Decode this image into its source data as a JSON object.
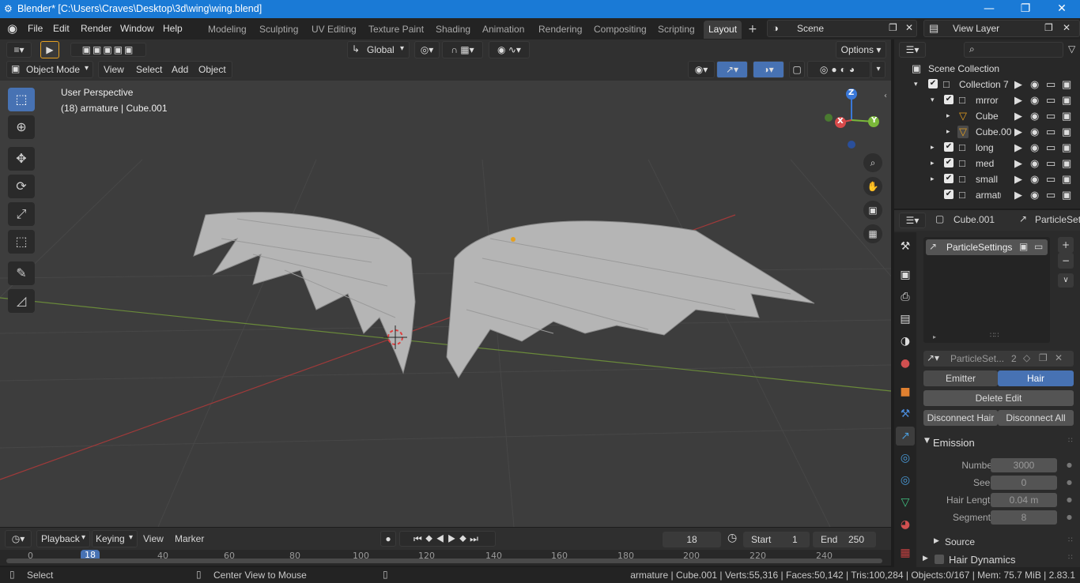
{
  "window": {
    "title": "Blender* [C:\\Users\\Craves\\Desktop\\3d\\wing\\wing.blend]",
    "minimize": "—",
    "maximize": "❐",
    "close": "✕",
    "icon": "blender-icon"
  },
  "menu": [
    "File",
    "Edit",
    "Render",
    "Window",
    "Help"
  ],
  "workspaces": [
    "Modeling",
    "Sculpting",
    "UV Editing",
    "Texture Paint",
    "Shading",
    "Animation",
    "Rendering",
    "Compositing",
    "Scripting",
    "Layout"
  ],
  "active_workspace": "Layout",
  "scene": "Scene",
  "view_layer": "View Layer",
  "viewport": {
    "mode": "Object Mode",
    "menus": [
      "View",
      "Select",
      "Add",
      "Object"
    ],
    "transform": "Global",
    "options": "Options",
    "info_line1": "User Perspective",
    "info_line2": "(18) armature | Cube.001",
    "gizmo": {
      "z": "Z",
      "y": "Y",
      "x": "X"
    }
  },
  "outliner": {
    "root": "Scene Collection",
    "rows": [
      "Collection 7",
      "mrror",
      "Cube",
      "Cube.00",
      "long",
      "med",
      "small",
      "armature"
    ]
  },
  "properties": {
    "object": "Cube.001",
    "settings_name": "ParticleSet",
    "slot": "ParticleSettings",
    "data_name": "ParticleSet...",
    "users": "2",
    "type_emitter": "Emitter",
    "type_hair": "Hair",
    "delete_edit": "Delete Edit",
    "disconnect_hair": "Disconnect Hair",
    "disconnect_all": "Disconnect All",
    "emission": "Emission",
    "fields": [
      {
        "label": "Number",
        "value": "3000"
      },
      {
        "label": "Seed",
        "value": "0"
      },
      {
        "label": "Hair Length",
        "value": "0.04 m"
      },
      {
        "label": "Segments",
        "value": "8"
      }
    ],
    "source": "Source",
    "hair_dynamics": "Hair Dynamics"
  },
  "timeline": {
    "menus": [
      "Playback",
      "Keying",
      "View",
      "Marker"
    ],
    "current_frame": "18",
    "start_label": "Start",
    "start": "1",
    "end_label": "End",
    "end": "250",
    "ticks": [
      "0",
      "18",
      "40",
      "60",
      "80",
      "100",
      "120",
      "140",
      "160",
      "180",
      "200",
      "220",
      "240"
    ]
  },
  "status": {
    "select": "Select",
    "center": "Center View to Mouse",
    "stats": "armature | Cube.001 | Verts:55,316 | Faces:50,142 | Tris:100,284 | Objects:0/167 | Mem: 75.7 MiB | 2.83.1"
  }
}
